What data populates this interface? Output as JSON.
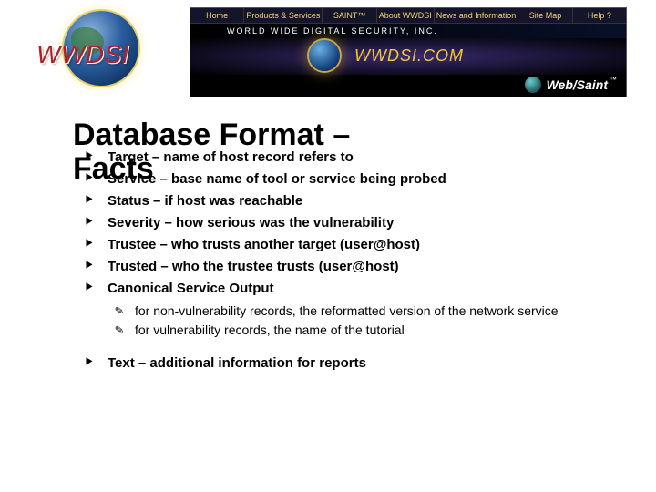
{
  "banner": {
    "logo_text": "WWDSI",
    "nav": [
      "Home",
      "Products & Services",
      "SAINT™",
      "About WWDSI",
      "News and Information",
      "Site Map",
      "Help ?"
    ],
    "tagline": "WORLD WIDE DIGITAL SECURITY, INC.",
    "domain": "WWDSI.COM",
    "product": "Web/Saint",
    "tm": "™"
  },
  "slide": {
    "title_line1": "Database Format –",
    "title_line2": "Facts",
    "bullets": [
      "Target – name of host record refers to",
      "Service – base name of tool or service being probed",
      "Status – if host was reachable",
      "Severity – how serious was the vulnerability",
      "Trustee – who trusts another target (user@host)",
      "Trusted – who the trustee trusts (user@host)",
      "Canonical Service Output"
    ],
    "sub_bullets": [
      "for non-vulnerability records, the reformatted version of the network service",
      "for vulnerability records, the name of the tutorial"
    ],
    "bullets_after": [
      "Text – additional information for reports"
    ]
  }
}
